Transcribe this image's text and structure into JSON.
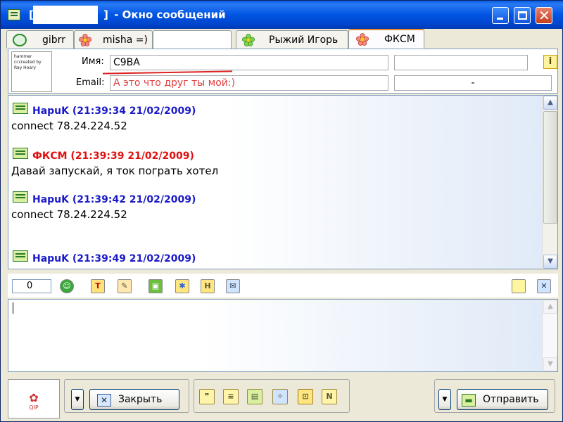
{
  "window": {
    "title_prefix": "[",
    "title_bracket": "]",
    "title_rest": " - Окно сообщений",
    "controls": {
      "minimize": "minimize",
      "maximize": "maximize",
      "close": "✕"
    }
  },
  "tabs": [
    {
      "label": "gibrr",
      "icon": "chat-bubble-icon"
    },
    {
      "label": "misha =)",
      "icon": "flower-red-icon"
    },
    {
      "label": "",
      "icon": ""
    },
    {
      "label": "Рыжий Игорь",
      "icon": "flower-green-icon"
    },
    {
      "label": "ФКСМ",
      "icon": "flower-red-icon",
      "active": true
    }
  ],
  "contact": {
    "avatar_text": "hammer cccreated by Ray Hoary",
    "name_label": "Имя:",
    "name_value": "C9BA",
    "email_label": "Email:",
    "email_value": "А это что друг ты мой:)",
    "extra_field_1": "",
    "extra_field_2": "-",
    "info_button": "i"
  },
  "messages": [
    {
      "sender": "НаpuK",
      "time": "(21:39:34 21/02/2009)",
      "text": "connect 78.24.224.52",
      "color": "#1a1ac8"
    },
    {
      "sender": "ФКСМ",
      "time": "(21:39:39 21/02/2009)",
      "text": "Давай запускай, я ток пограть хотел",
      "color": "#e01010"
    },
    {
      "sender": "НаpuK",
      "time": "(21:39:42 21/02/2009)",
      "text": "connect 78.24.224.52",
      "color": "#1a1ac8"
    },
    {
      "sender": "НаpuK",
      "time": "(21:39:49 21/02/2009)",
      "text": "",
      "color": "#1a1ac8"
    }
  ],
  "toolbar": {
    "char_count": "0",
    "tools": [
      "smiley-icon",
      "text-color-icon",
      "paint-icon",
      "save-icon",
      "picture-icon",
      "history-icon",
      "image-link-icon"
    ],
    "right_tools": [
      "note-icon",
      "close-panel-icon"
    ]
  },
  "composer": {
    "value": ""
  },
  "bottom": {
    "close_label": "Закрыть",
    "send_label": "Отправить",
    "logo_text": "QIP",
    "format_tools": [
      "quote-icon",
      "list-icon",
      "file-icon",
      "wrench-icon",
      "lock-icon",
      "n-icon"
    ]
  },
  "colors": {
    "titlebar": "#0054e3",
    "tab_active_accent": "#e68b2c",
    "msg_blue": "#1a1ac8",
    "msg_red": "#e01010"
  }
}
